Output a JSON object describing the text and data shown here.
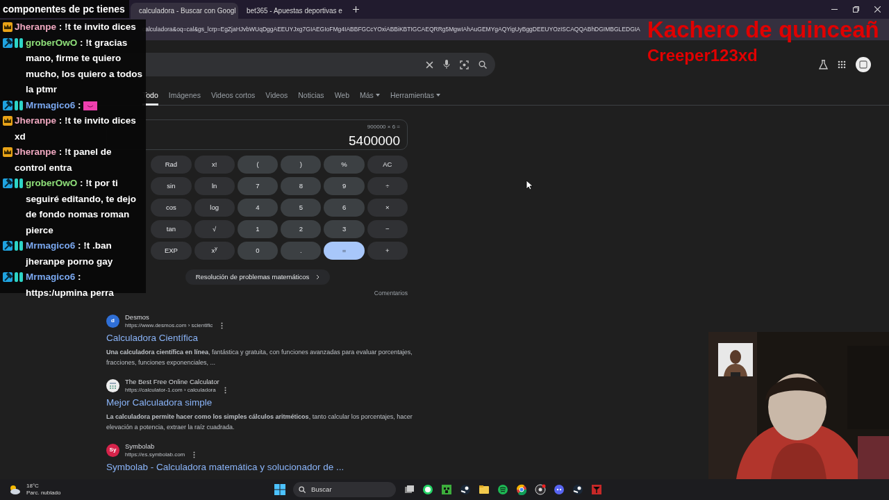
{
  "tabs": [
    {
      "title": "calculadora - Buscar con Googl",
      "selected": true
    },
    {
      "title": "bet365 - Apuestas deportivas e",
      "selected": false
    }
  ],
  "address_bar": {
    "url": "calculadora&oq=cal&gs_lcrp=EgZjaHJvbWUqDggAEEUYJxg7GIAEGIoFMg4IABBFGCcYOxiABBiKBTIGCAEQRRg5MgwIAhAuGEMYgAQYigUyBggDEEUYOzISCAQQABhDGIMBGLEDGIA"
  },
  "search_nav": [
    {
      "label": "Todo",
      "selected": true,
      "menu": false
    },
    {
      "label": "Imágenes",
      "selected": false,
      "menu": false
    },
    {
      "label": "Videos cortos",
      "selected": false,
      "menu": false
    },
    {
      "label": "Videos",
      "selected": false,
      "menu": false
    },
    {
      "label": "Noticias",
      "selected": false,
      "menu": false
    },
    {
      "label": "Web",
      "selected": false,
      "menu": false
    },
    {
      "label": "Más",
      "selected": false,
      "menu": true
    },
    {
      "label": "Herramientas",
      "selected": false,
      "menu": true
    }
  ],
  "calculator": {
    "expression": "900000 × 6 =",
    "result": "5400000",
    "keys": [
      [
        {
          "label": "Rad",
          "kind": "fn"
        },
        {
          "label": "x!",
          "kind": "fn"
        },
        {
          "label": "(",
          "kind": "num"
        },
        {
          "label": ")",
          "kind": "num"
        },
        {
          "label": "%",
          "kind": "num"
        },
        {
          "label": "AC",
          "kind": "fn"
        }
      ],
      [
        {
          "label": "sin",
          "kind": "fn"
        },
        {
          "label": "ln",
          "kind": "fn"
        },
        {
          "label": "7",
          "kind": "num"
        },
        {
          "label": "8",
          "kind": "num"
        },
        {
          "label": "9",
          "kind": "num"
        },
        {
          "label": "÷",
          "kind": "fn"
        }
      ],
      [
        {
          "label": "cos",
          "kind": "fn"
        },
        {
          "label": "log",
          "kind": "fn"
        },
        {
          "label": "4",
          "kind": "num"
        },
        {
          "label": "5",
          "kind": "num"
        },
        {
          "label": "6",
          "kind": "num"
        },
        {
          "label": "×",
          "kind": "fn"
        }
      ],
      [
        {
          "label": "tan",
          "kind": "fn"
        },
        {
          "label": "√",
          "kind": "fn"
        },
        {
          "label": "1",
          "kind": "num"
        },
        {
          "label": "2",
          "kind": "num"
        },
        {
          "label": "3",
          "kind": "num"
        },
        {
          "label": "−",
          "kind": "fn"
        }
      ],
      [
        {
          "label": "EXP",
          "kind": "fn"
        },
        {
          "label": "x$^{y}$",
          "kind": "fn"
        },
        {
          "label": "0",
          "kind": "num"
        },
        {
          "label": ".",
          "kind": "num"
        },
        {
          "label": "=",
          "kind": "equals"
        },
        {
          "label": "+",
          "kind": "fn"
        }
      ]
    ],
    "solver_link": "Resolución de problemas matemáticos",
    "feedback": "Comentarios"
  },
  "results": [
    {
      "kind": "letter",
      "site": "Desmos",
      "url": "https://www.desmos.com › scientific",
      "icon_text": "d",
      "title": "Calculadora Científica",
      "snippet": "**Una calculadora científica en línea**, fantástica y gratuita, con funciones avanzadas para evaluar porcentajes, fracciones, funciones exponenciales, ..."
    },
    {
      "kind": "grid",
      "site": "The Best Free Online Calculator",
      "url": "https://calculator-1.com › calculadora",
      "title": "Mejor Calculadora simple",
      "snippet": "**La calculadora permite hacer como los simples cálculos aritméticos**, tanto calcular los porcentajes, hacer elevación a potencia, extraer la raíz cuadrada."
    },
    {
      "kind": "letter",
      "site": "Symbolab",
      "url": "https://es.symbolab.com",
      "icon_text": "Sy",
      "title": "Symbolab - Calculadora matemática y solucionador de ..."
    }
  ],
  "chat": {
    "first_line": "componentes de pc tienes",
    "messages": [
      {
        "kind": "vip",
        "user": "Jheranpe",
        "color": "#f0a8c0",
        "text": ": !t te invito dices"
      },
      {
        "kind": "mod",
        "user": "groberOwO",
        "color": "#8fe07a",
        "text": ": !t gracias mano, firme te quiero mucho, los quiero a todos la ptmr"
      },
      {
        "kind": "mod",
        "user": "Mrmagico6",
        "color": "#7aa8f0",
        "text": ":",
        "emote": true
      },
      {
        "kind": "vip",
        "user": "Jheranpe",
        "color": "#f0a8c0",
        "text": ": !t te invito dices xd"
      },
      {
        "kind": "vip",
        "user": "Jheranpe",
        "color": "#f0a8c0",
        "text": ": !t panel de control entra"
      },
      {
        "kind": "mod",
        "user": "groberOwO",
        "color": "#8fe07a",
        "text": ": !t por ti seguiré editando, te dejo de fondo nomas roman pierce"
      },
      {
        "kind": "mod",
        "user": "Mrmagico6",
        "color": "#7aa8f0",
        "text": ": !t .ban jheranpe porno gay"
      },
      {
        "kind": "mod",
        "user": "Mrmagico6",
        "color": "#7aa8f0",
        "text": ": https:/upmina perra"
      }
    ]
  },
  "stream_text": [
    "Kachero de quinceañ",
    "Creeper123xd"
  ],
  "taskbar": {
    "temperature": "18°C",
    "weather": "Parc. nublado",
    "search": "Buscar"
  }
}
